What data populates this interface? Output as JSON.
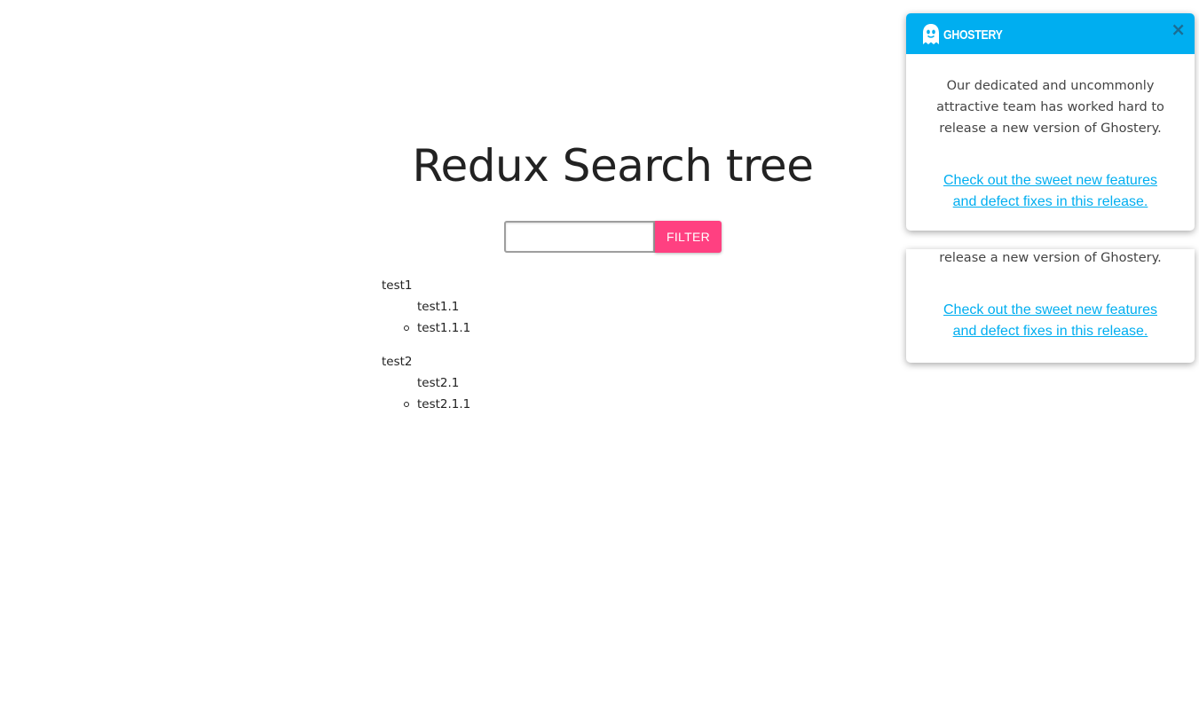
{
  "page": {
    "title": "Redux Search tree"
  },
  "search": {
    "value": "",
    "placeholder": "",
    "button_label": "FILTER"
  },
  "tree": [
    {
      "label": "test1",
      "child": "test1.1",
      "grandchild": "test1.1.1"
    },
    {
      "label": "test2",
      "child": "test2.1",
      "grandchild": "test2.1.1"
    }
  ],
  "ghostery": {
    "brand": "GHOSTERY",
    "close_symbol": "×",
    "message": "Our dedicated and uncommonly attractive team has worked hard to release a new version of Ghostery.",
    "back_message_visible": "release a new version of Ghostery.",
    "link_text": "Check out the sweet new features and defect fixes in this release.",
    "header_color": "#00aef0",
    "link_color": "#00aef0"
  },
  "colors": {
    "filter_button": "#ff4081"
  }
}
